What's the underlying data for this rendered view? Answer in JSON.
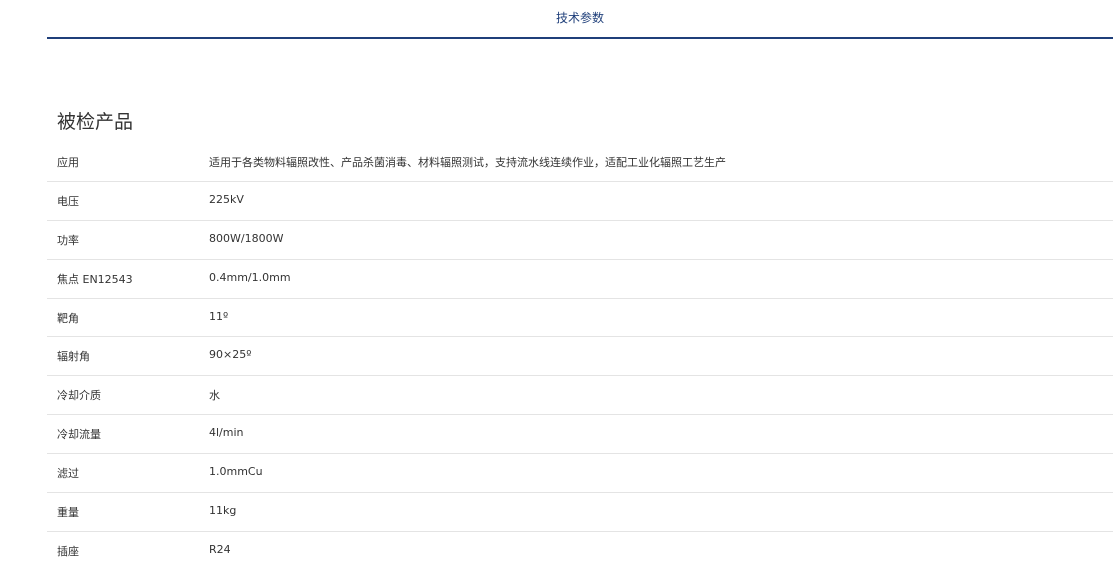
{
  "tabs": {
    "active_label": "技术参数"
  },
  "section": {
    "title": "被检产品"
  },
  "specs": [
    {
      "label": "应用",
      "value": "适用于各类物料辐照改性、产品杀菌消毒、材料辐照测试，支持流水线连续作业，适配工业化辐照工艺生产"
    },
    {
      "label": "电压",
      "value": "225kV"
    },
    {
      "label": "功率",
      "value": "800W/1800W"
    },
    {
      "label": "焦点 EN12543",
      "value": "0.4mm/1.0mm"
    },
    {
      "label": "靶角",
      "value": "11º"
    },
    {
      "label": "辐射角",
      "value": "90×25º"
    },
    {
      "label": "冷却介质",
      "value": "水"
    },
    {
      "label": "冷却流量",
      "value": "4l/min"
    },
    {
      "label": "滤过",
      "value": "1.0mmCu"
    },
    {
      "label": "重量",
      "value": "11kg"
    },
    {
      "label": "插座",
      "value": "R24"
    }
  ]
}
